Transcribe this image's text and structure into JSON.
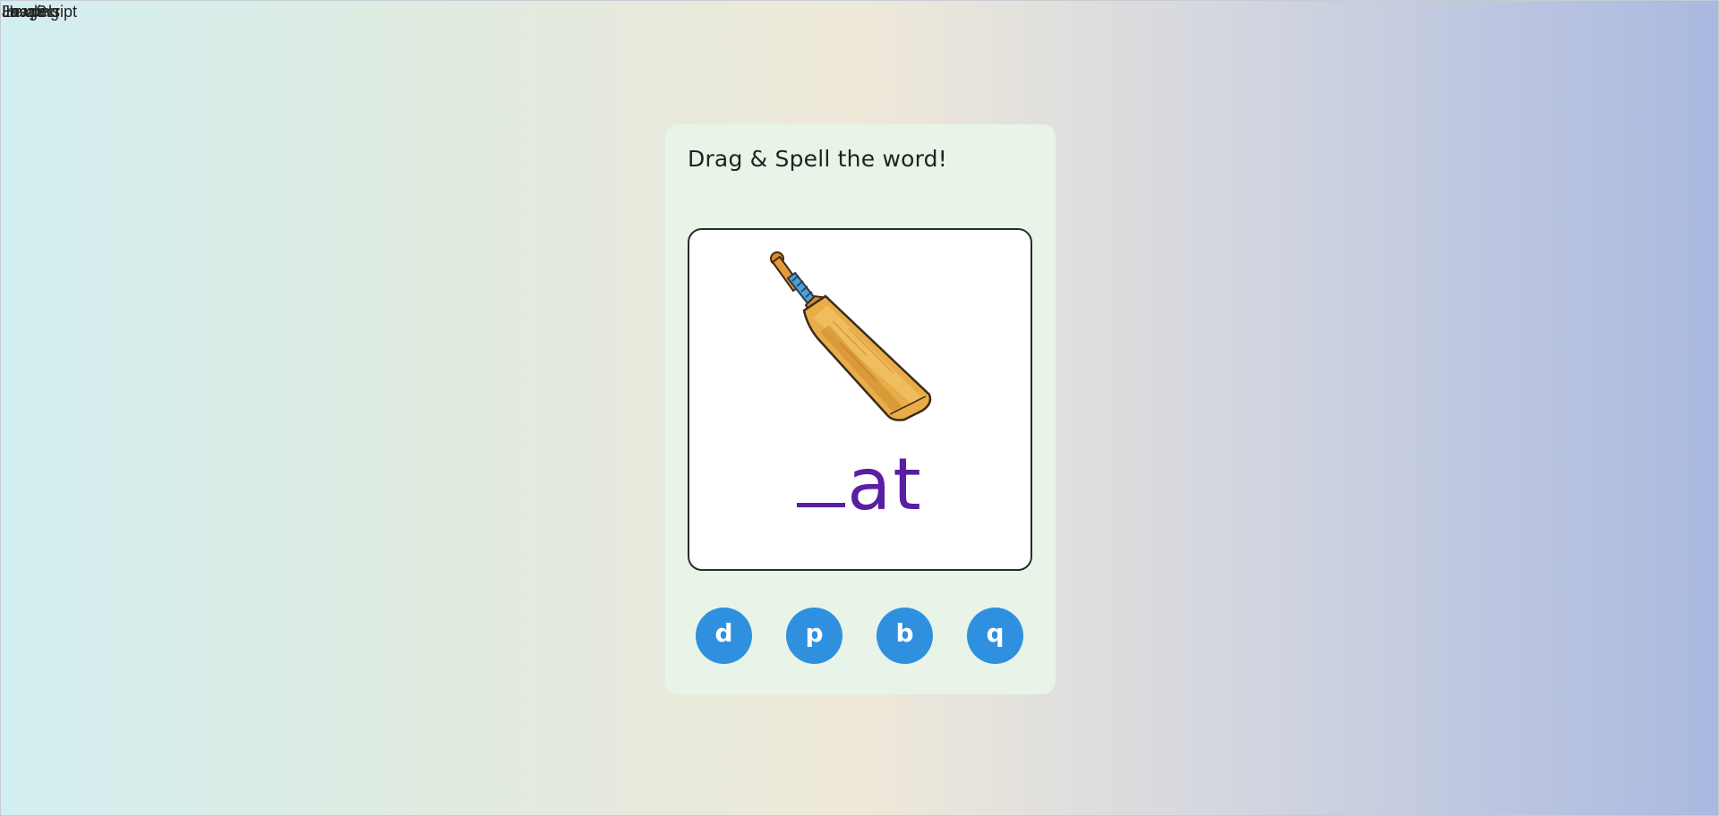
{
  "overlap_labels": [
    "Loading",
    "Hexpels",
    "Image",
    "JavaScript"
  ],
  "game": {
    "prompt": "Drag & Spell the word!",
    "picture_icon": "cricket-bat",
    "word_blank": "_",
    "word_suffix": "at",
    "letters": [
      {
        "label": "d"
      },
      {
        "label": "p"
      },
      {
        "label": "b"
      },
      {
        "label": "q"
      }
    ]
  },
  "colors": {
    "card_background": "#e7f4e7",
    "word_color": "#5a1ea3",
    "letter_button": "#2f90e0"
  }
}
